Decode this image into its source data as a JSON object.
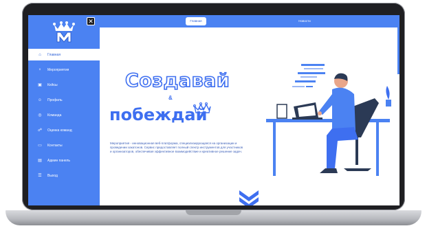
{
  "app": {
    "logo_icon": "crown-m-logo",
    "close_icon": "close-icon",
    "accent_color": "#4b82f2"
  },
  "topbar": {
    "tabs": [
      {
        "label": "Главная",
        "active": true
      },
      {
        "label": "Новости",
        "active": false
      }
    ]
  },
  "sidebar": {
    "items": [
      {
        "label": "Главная",
        "icon": "home-icon",
        "active": true
      },
      {
        "label": "Мероприятия",
        "icon": "trophy-icon",
        "active": false
      },
      {
        "label": "Кейсы",
        "icon": "briefcase-icon",
        "active": false
      },
      {
        "label": "Профиль",
        "icon": "user-icon",
        "active": false
      },
      {
        "label": "Команда",
        "icon": "team-icon",
        "active": false
      },
      {
        "label": "Оценка команд",
        "icon": "rating-icon",
        "active": false
      },
      {
        "label": "Контакты",
        "icon": "contacts-icon",
        "active": false
      },
      {
        "label": "Админ панель",
        "icon": "admin-icon",
        "active": false
      },
      {
        "label": "Выход",
        "icon": "logout-icon",
        "active": false
      }
    ]
  },
  "hero": {
    "title_line1": "Создавай",
    "title_and": "&",
    "title_line2": "побеждай",
    "description": "Мероприятия - инновационная веб-платформа, специализирующаяся на организации и проведении хакатонов. Сервис предоставляет полный спектр инструментов для участников и организаторов, обеспечивая эффективное взаимодействие и креативное решение задач.",
    "scroll_down_icon": "double-chevron-down-icon",
    "illustration": "developer-at-desk-illustration"
  }
}
